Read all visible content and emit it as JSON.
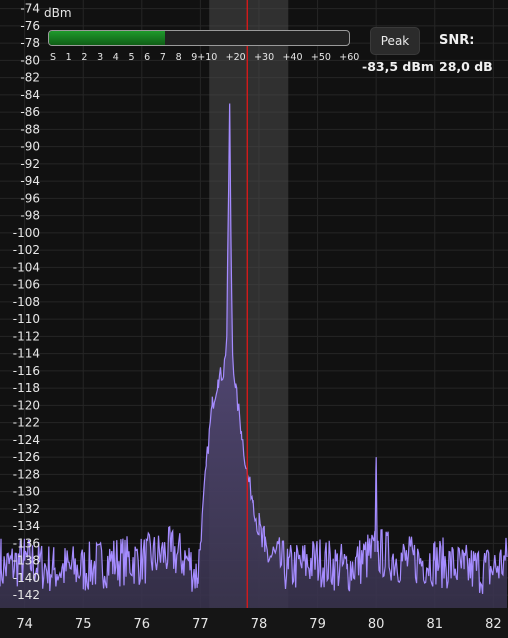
{
  "chart_data": {
    "type": "area",
    "y_unit": "dBm",
    "y_ticks": [
      "-74",
      "-76",
      "-78",
      "-80",
      "-82",
      "-84",
      "-86",
      "-88",
      "-90",
      "-92",
      "-94",
      "-96",
      "-98",
      "-100",
      "-102",
      "-104",
      "-106",
      "-108",
      "-110",
      "-112",
      "-114",
      "-116",
      "-118",
      "-120",
      "-122",
      "-124",
      "-126",
      "-128",
      "-130",
      "-132",
      "-134",
      "-136",
      "-138",
      "-140",
      "-142"
    ],
    "x_ticks": [
      "74",
      "75",
      "76",
      "77",
      "78",
      "79",
      "80",
      "81",
      "82"
    ],
    "xlim": [
      73.58,
      82.25
    ],
    "ylim": [
      -143.5,
      -73
    ],
    "series": [
      {
        "x": [
          73.6,
          74.0,
          74.5,
          75.0,
          75.5,
          76.0,
          76.5,
          76.8,
          76.95,
          77.0,
          77.1,
          77.2,
          77.3,
          77.4,
          77.45,
          77.5,
          77.52,
          77.55,
          77.6,
          77.7,
          77.8,
          77.9,
          78.0,
          78.1,
          78.5,
          79.0,
          79.5,
          79.98,
          80.0,
          80.02,
          80.5,
          81.0,
          81.5,
          82.0,
          82.2
        ],
        "y": [
          -139,
          -138,
          -139,
          -139,
          -138,
          -138,
          -137,
          -138,
          -140,
          -136,
          -127,
          -120,
          -117,
          -116,
          -112,
          -85,
          -100,
          -114,
          -118,
          -123,
          -128,
          -131,
          -135,
          -137,
          -139,
          -138,
          -139,
          -137,
          -126,
          -137,
          -138,
          -138,
          -139,
          -139,
          -138
        ]
      }
    ],
    "markers": {
      "passband_x": [
        77.15,
        78.5
      ],
      "tuned_frequency": 77.8
    },
    "grid": true
  },
  "smeter": {
    "scale_labels": [
      "S",
      "1",
      "2",
      "3",
      "4",
      "5",
      "6",
      "7",
      "8",
      "9",
      "+10",
      "+20",
      "+30",
      "+40",
      "+50",
      "+60"
    ],
    "level_fraction": 0.385
  },
  "controls": {
    "peak_label": "Peak",
    "snr_label": "SNR:",
    "peak_value": "-83,5 dBm",
    "snr_value": "28,0 dB"
  },
  "colors": {
    "spectrum_line": "#a58cff",
    "spectrum_fill": "#6a5a9c",
    "tuning_marker": "#e01818",
    "passband": "#505050",
    "meter_fill": "#1f9a2c"
  }
}
